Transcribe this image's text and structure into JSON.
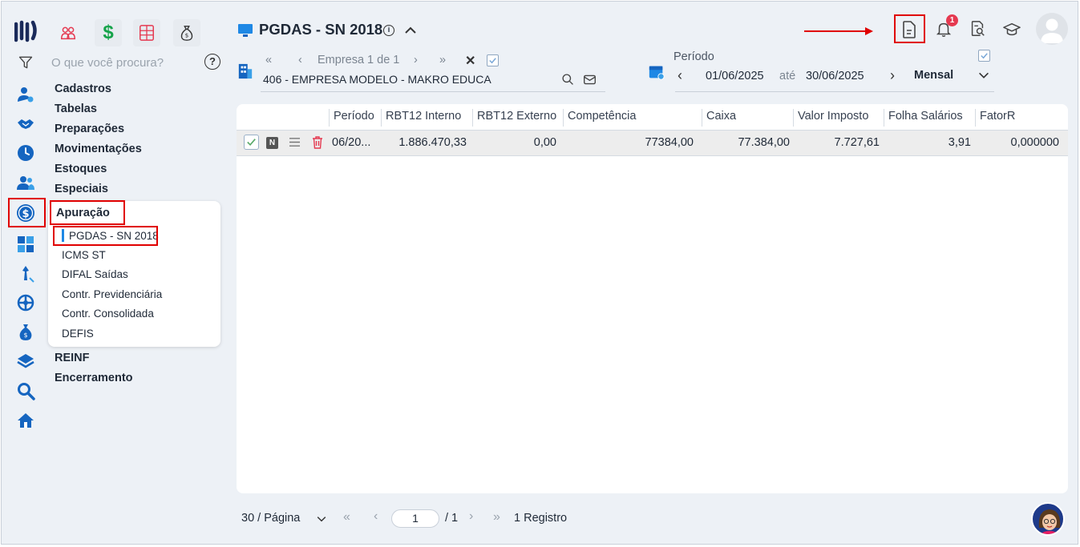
{
  "search": {
    "placeholder": "O que você procura?",
    "help": "?"
  },
  "menu": {
    "items": [
      "Cadastros",
      "Tabelas",
      "Preparações",
      "Movimentações",
      "Estoques",
      "Especiais"
    ],
    "active": "Apuração",
    "submenu": [
      "PGDAS - SN 2018",
      "ICMS ST",
      "DIFAL Saídas",
      "Contr. Previdenciária",
      "Contr. Consolidada",
      "DEFIS"
    ],
    "after": [
      "REINF",
      "Encerramento"
    ]
  },
  "header": {
    "title": "PGDAS - SN 2018",
    "notifications_count": "1"
  },
  "empresa": {
    "nav_label": "Empresa 1 de 1",
    "value": "406 - EMPRESA MODELO - MAKRO EDUCA"
  },
  "periodo": {
    "label": "Período",
    "start": "01/06/2025",
    "sep": "até",
    "end": "30/06/2025",
    "mode": "Mensal"
  },
  "table": {
    "columns": [
      "Período",
      "RBT12 Interno",
      "RBT12 Externo",
      "Competência",
      "Caixa",
      "Valor Imposto",
      "Folha Salários",
      "FatorR"
    ],
    "rows": [
      {
        "tag": "N",
        "periodo": "06/20...",
        "rbt12_interno": "1.886.470,33",
        "rbt12_externo": "0,00",
        "competencia": "77384,00",
        "caixa": "77.384,00",
        "valor_imposto": "7.727,61",
        "folha_salarios": "3,91",
        "fatorr": "0,000000"
      }
    ]
  },
  "footer": {
    "page_size": "30 / Página",
    "page": "1",
    "total_pages": "/ 1",
    "records": "1 Registro"
  },
  "colors": {
    "accent": "#1e88e5",
    "highlight": "#e00000",
    "rail_icon": "#1565c0"
  }
}
